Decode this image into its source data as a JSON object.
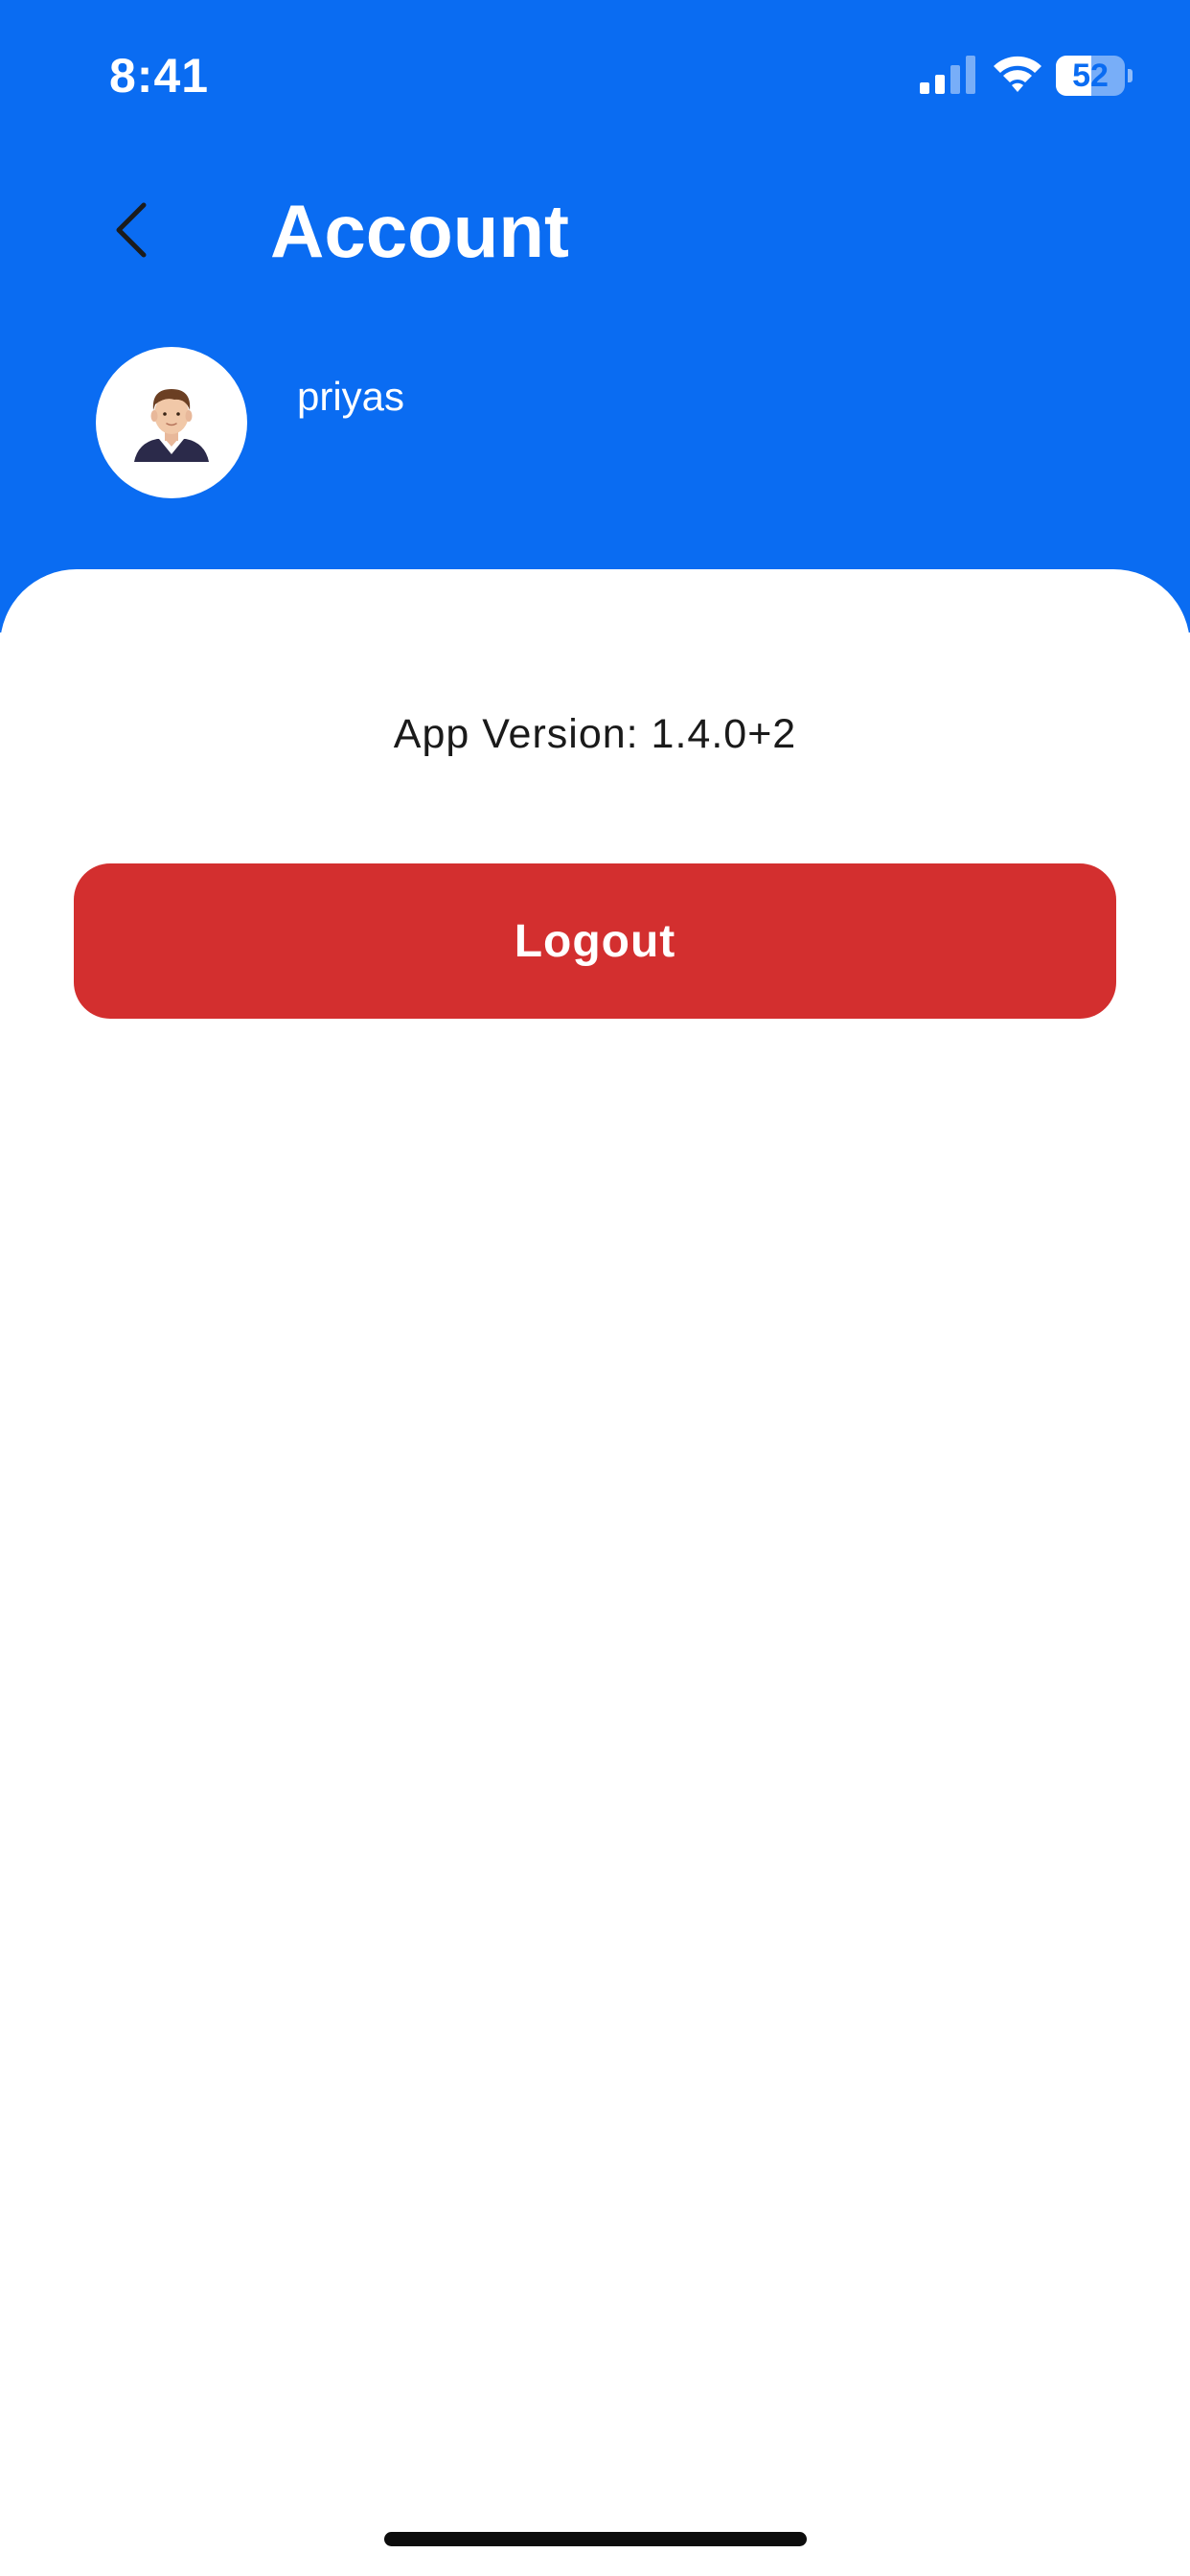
{
  "status_bar": {
    "time": "8:41",
    "signal_icon": "cellular-signal-icon",
    "signal_bars_active": 2,
    "signal_bars_total": 4,
    "wifi_icon": "wifi-icon",
    "battery_icon": "battery-icon",
    "battery_level": "52",
    "battery_fraction": 0.52
  },
  "header": {
    "back_icon": "chevron-left-icon",
    "title": "Account",
    "avatar_icon": "user-avatar-icon",
    "username": "priyas"
  },
  "main": {
    "app_version": "App Version: 1.4.0+2",
    "logout_label": "Logout"
  },
  "colors": {
    "header_background": "#0a6cf2",
    "logout_button": "#d32f2f",
    "page_background": "#ffffff"
  }
}
